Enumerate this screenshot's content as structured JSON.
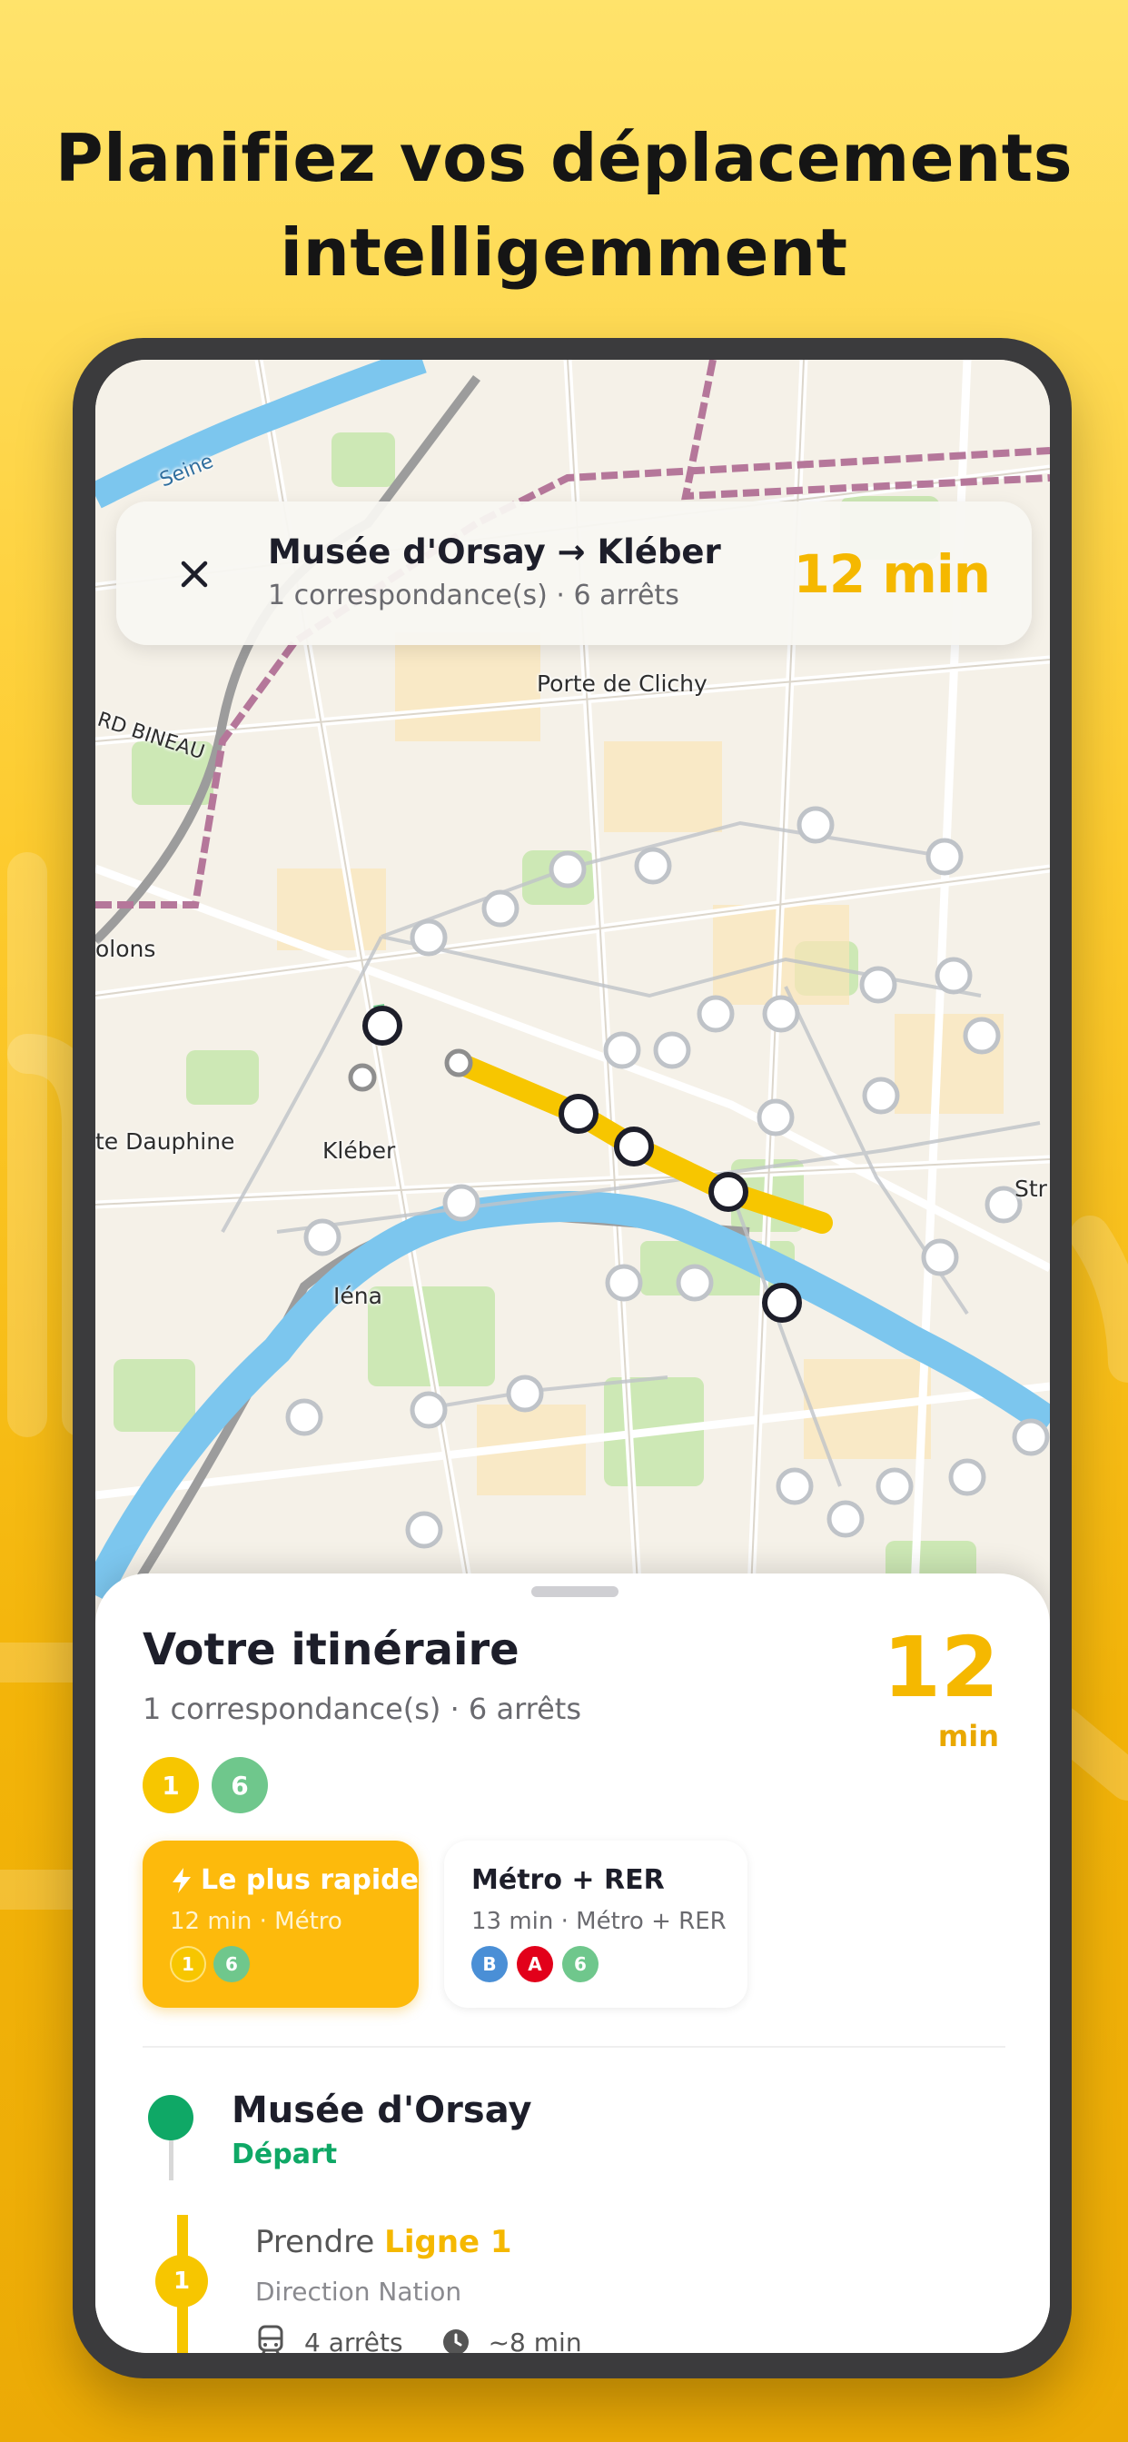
{
  "headline": {
    "line1": "Planifiez vos déplacements",
    "line2": "intelligemment"
  },
  "colors": {
    "accent": "#F5B800",
    "line1": "#F7C600",
    "line6": "#6FC78C",
    "rer_b": "#4A8FD6",
    "rer_a": "#E2001A",
    "depart_green": "#0FA866"
  },
  "map": {
    "labels": {
      "seine": "Seine",
      "porte_clichy": "Porte de Clichy",
      "rd_bineau": "RD BINEAU",
      "olons": "olons",
      "te_dauphine": "te Dauphine",
      "kleber": "Kléber",
      "iena": "Iéna",
      "str": "Str"
    }
  },
  "route_card": {
    "close_icon": "close-icon",
    "title": "Musée d'Orsay → Kléber",
    "subtitle": "1 correspondance(s) · 6 arrêts",
    "duration": "12 min"
  },
  "sheet": {
    "title": "Votre itinéraire",
    "subtitle": "1 correspondance(s) · 6 arrêts",
    "duration_value": "12",
    "duration_unit": "min",
    "lines": [
      "1",
      "6"
    ],
    "options": [
      {
        "title": "Le plus rapide",
        "icon": "lightning-icon",
        "subtitle": "12 min · Métro",
        "badges": [
          "1",
          "6"
        ]
      },
      {
        "title": "Métro + RER",
        "subtitle": "13 min · Métro + RER",
        "badges": [
          "B",
          "A",
          "6"
        ]
      }
    ],
    "departure": {
      "station": "Musée d'Orsay",
      "label": "Départ"
    },
    "step": {
      "line_number": "1",
      "take_prefix": "Prendre",
      "line_name": "Ligne 1",
      "direction": "Direction Nation",
      "stops": "4 arrêts",
      "duration": "~8 min"
    }
  }
}
